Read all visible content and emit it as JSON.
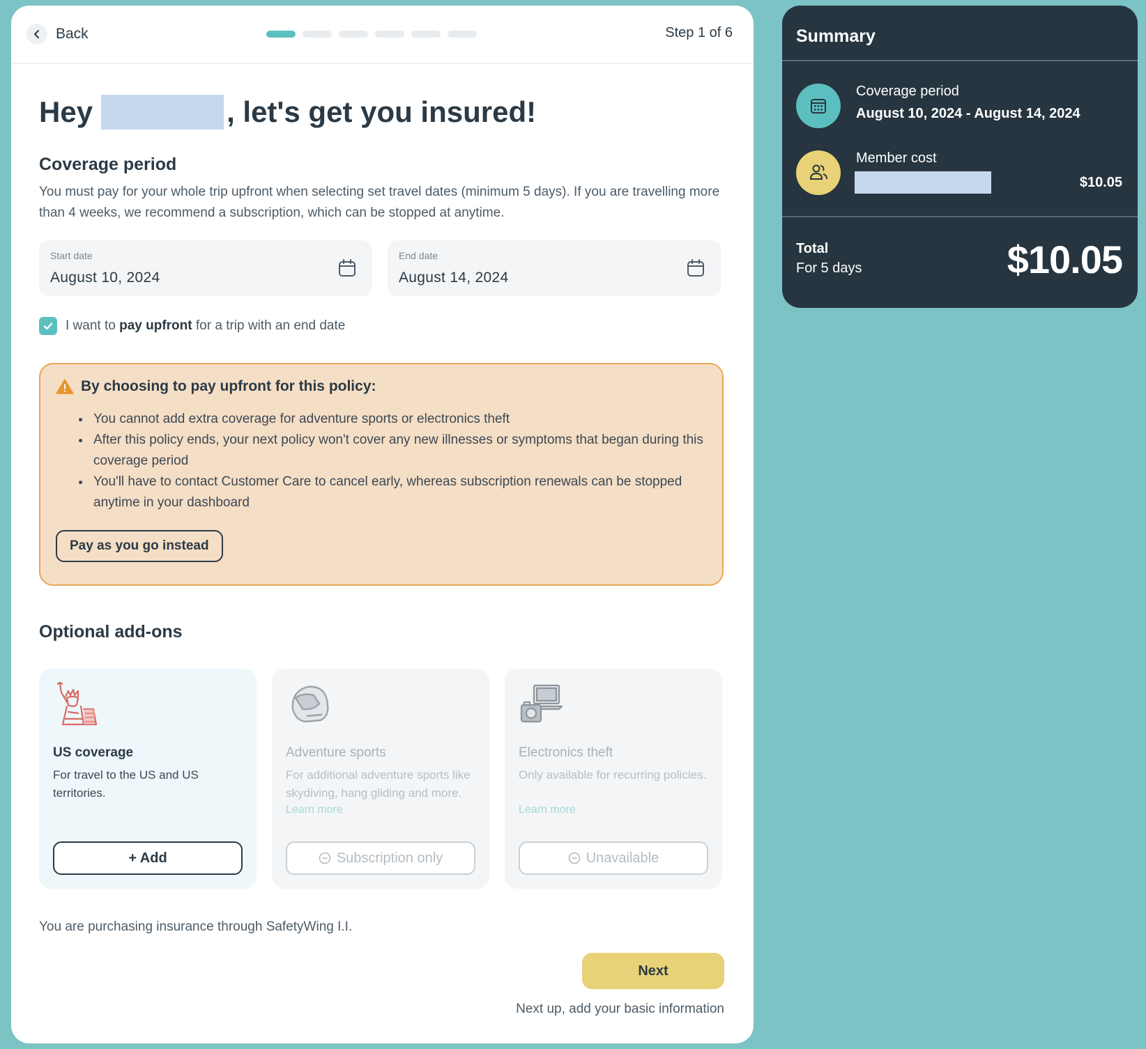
{
  "header": {
    "back_label": "Back",
    "step_text": "Step 1 of 6",
    "progress": {
      "current": 1,
      "total": 6
    }
  },
  "greeting": {
    "prefix": "Hey",
    "suffix": ", let's get you insured!"
  },
  "coverage": {
    "title": "Coverage period",
    "description": "You must pay for your whole trip upfront when selecting set travel dates (minimum 5 days). If you are travelling more than 4 weeks, we recommend a subscription, which can be stopped at anytime.",
    "start_label": "Start date",
    "start_value": "August 10, 2024",
    "end_label": "End date",
    "end_value": "August 14, 2024"
  },
  "upfront_checkbox": {
    "checked": true,
    "text_before": "I want to",
    "text_bold": "pay upfront",
    "text_after": "for a trip with an end date"
  },
  "warning": {
    "title": "By choosing to pay upfront for this policy:",
    "items": [
      "You cannot add extra coverage for adventure sports or electronics theft",
      "After this policy ends, your next policy won't cover any new illnesses or symptoms that began during this coverage period",
      "You'll have to contact Customer Care to cancel early, whereas subscription renewals can be stopped anytime in your dashboard"
    ],
    "button_label": "Pay as you go instead"
  },
  "addons": {
    "title": "Optional add-ons",
    "items": [
      {
        "name": "US coverage",
        "desc": "For travel to the US and US territories.",
        "learn_more": "",
        "button": "+ Add",
        "icon": "statue-of-liberty-icon"
      },
      {
        "name": "Adventure sports",
        "desc": "For additional adventure sports like skydiving, hang gliding and more.",
        "learn_more": "Learn more",
        "button": "Subscription only",
        "icon": "helmet-icon"
      },
      {
        "name": "Electronics theft",
        "desc": "Only available for recurring policies.",
        "learn_more": "Learn more",
        "button": "Unavailable",
        "icon": "electronics-icon"
      }
    ]
  },
  "footer": {
    "purchase_note": "You are purchasing insurance through SafetyWing I.I.",
    "next_label": "Next",
    "next_note": "Next up, add your basic information"
  },
  "summary": {
    "title": "Summary",
    "coverage_label": "Coverage period",
    "coverage_value": "August 10, 2024 - August 14, 2024",
    "member_label": "Member cost",
    "member_cost": "$10.05",
    "total_label": "Total",
    "total_sub": "For 5 days",
    "total_amount": "$10.05"
  },
  "colors": {
    "background": "#7cc3c6",
    "accent_teal": "#5cbfbf",
    "summary_bg": "#26353f",
    "next_button": "#e8d176",
    "warning_bg": "#f5dec6",
    "warning_border": "#e8a757"
  }
}
